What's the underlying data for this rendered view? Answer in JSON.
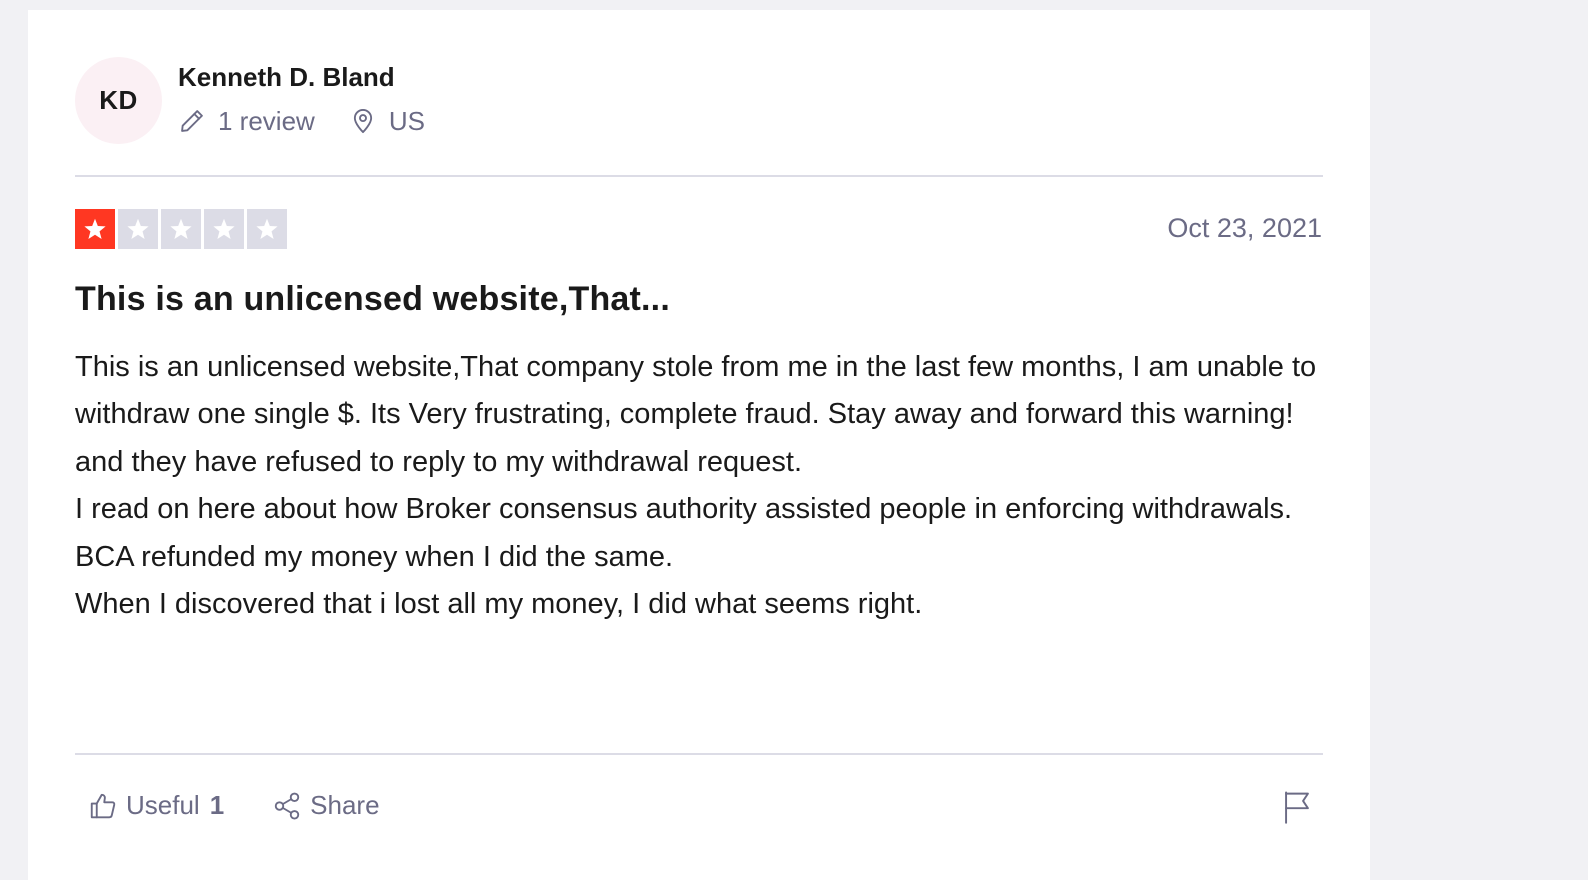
{
  "consumer": {
    "initials": "KD",
    "name": "Kenneth D. Bland",
    "reviews_count": "1 review",
    "country": "US"
  },
  "review": {
    "rating": 1,
    "max_rating": 5,
    "date": "Oct 23, 2021",
    "title": "This is an unlicensed website,That...",
    "body": "This is an unlicensed website,That company stole from me in the last few months, I am unable to withdraw one single $. Its Very frustrating, complete fraud. Stay away and forward this warning! and they have refused to reply to my withdrawal request.\nI read on here about how Broker consensus authority assisted people in enforcing withdrawals.\nBCA refunded my money when I did the same.\nWhen I discovered that i lost all my money, I did what seems right."
  },
  "actions": {
    "useful_label": "Useful",
    "useful_count": "1",
    "share_label": "Share"
  },
  "colors": {
    "star_filled": "#ff3722",
    "star_empty": "#dcdce6",
    "avatar_bg": "#fbf0f4",
    "muted_text": "#6b6b85"
  },
  "icons": {
    "reviews": "pencil-icon",
    "location": "map-pin-icon",
    "useful": "thumbs-up-icon",
    "share": "share-icon",
    "report": "flag-icon",
    "rating": "star-icon"
  }
}
